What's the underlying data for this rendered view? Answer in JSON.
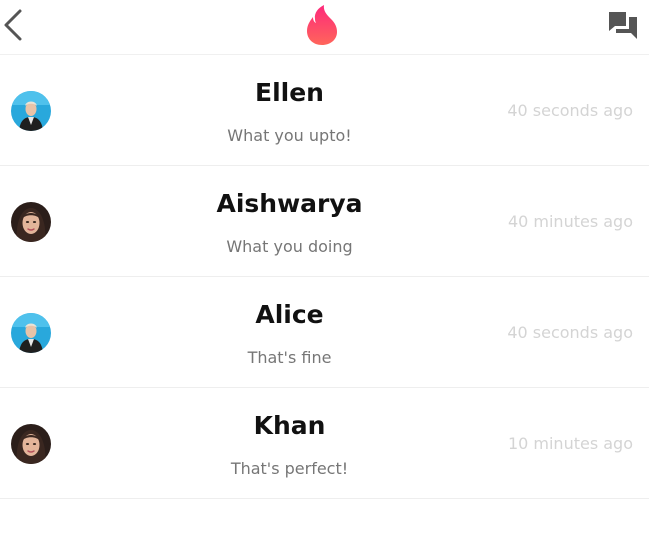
{
  "header": {
    "back_icon": "chevron-left-icon",
    "logo_icon": "flame-icon",
    "messages_icon": "chat-bubbles-icon",
    "logo_gradient": [
      "#fd297b",
      "#ff655b"
    ],
    "icon_color": "#555555"
  },
  "conversations": [
    {
      "name": "Ellen",
      "message": "What you upto!",
      "time": "40 seconds ago",
      "avatar": "ellen"
    },
    {
      "name": "Aishwarya",
      "message": "What you doing",
      "time": "40 minutes ago",
      "avatar": "aishwarya"
    },
    {
      "name": "Alice",
      "message": "That's fine",
      "time": "40 seconds ago",
      "avatar": "ellen"
    },
    {
      "name": "Khan",
      "message": "That's perfect!",
      "time": "10 minutes ago",
      "avatar": "aishwarya"
    }
  ]
}
